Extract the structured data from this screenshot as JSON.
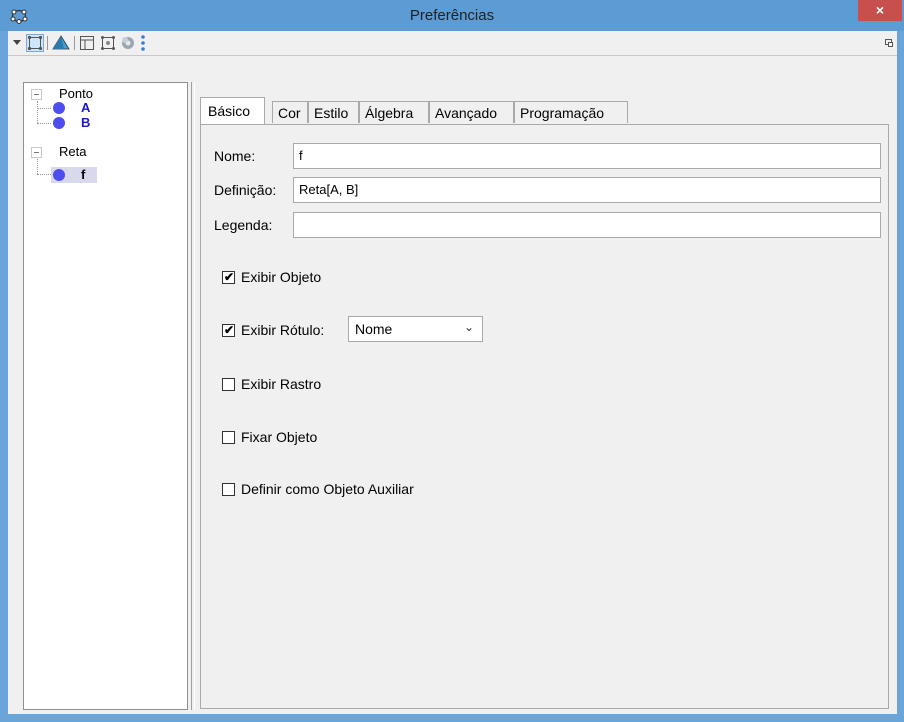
{
  "window": {
    "title": "Preferências",
    "close_label": "×"
  },
  "toolbar": {
    "items": [
      "menu-arrow-icon",
      "graphics-icon",
      "graphics-3d-icon",
      "layout-icon",
      "spreadsheet-icon",
      "settings-icon",
      "more-icon",
      "restore-icon"
    ]
  },
  "tree": {
    "groups": [
      {
        "label": "Ponto",
        "items": [
          {
            "label": "A"
          },
          {
            "label": "B"
          }
        ]
      },
      {
        "label": "Reta",
        "items": [
          {
            "label": "f"
          }
        ]
      }
    ]
  },
  "tabs": [
    "Básico",
    "Cor",
    "Estilo",
    "Álgebra",
    "Avançado",
    "Programação"
  ],
  "basic": {
    "name_label": "Nome:",
    "name_value": "f",
    "definition_label": "Definição:",
    "definition_value": "Reta[A, B]",
    "caption_label": "Legenda:",
    "caption_value": "",
    "show_object": {
      "label": "Exibir Objeto",
      "checked": true
    },
    "show_label": {
      "label": "Exibir Rótulo:",
      "checked": true,
      "select_value": "Nome"
    },
    "show_trace": {
      "label": "Exibir Rastro",
      "checked": false
    },
    "fix_object": {
      "label": "Fixar Objeto",
      "checked": false
    },
    "auxiliary": {
      "label": "Definir como Objeto Auxiliar",
      "checked": false
    }
  },
  "colors": {
    "titlebar": "#5c9bd4",
    "close": "#c7504d",
    "point": "#4d4df0",
    "point_label": "#1a1acc"
  }
}
